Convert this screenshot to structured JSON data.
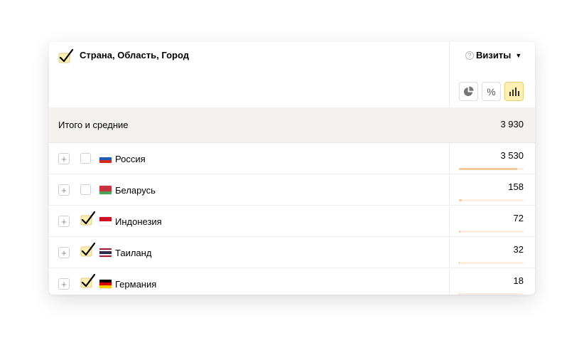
{
  "header": {
    "title": "Страна, Область, Город",
    "metric": "Визиты",
    "help_glyph": "?",
    "caret": "▼",
    "view_buttons": [
      {
        "name": "pie-chart-icon",
        "active": false
      },
      {
        "name": "percent-icon",
        "label": "%",
        "active": false
      },
      {
        "name": "bar-chart-icon",
        "active": true
      }
    ]
  },
  "totals": {
    "label": "Итого и средние",
    "value": "3 930"
  },
  "rows": [
    {
      "label": "Россия",
      "value": "3 530",
      "share": 0.898,
      "checked": false,
      "flag": "ru"
    },
    {
      "label": "Беларусь",
      "value": "158",
      "share": 0.04,
      "checked": false,
      "flag": "by"
    },
    {
      "label": "Индонезия",
      "value": "72",
      "share": 0.018,
      "checked": true,
      "flag": "id"
    },
    {
      "label": "Таиланд",
      "value": "32",
      "share": 0.008,
      "checked": true,
      "flag": "th"
    },
    {
      "label": "Германия",
      "value": "18",
      "share": 0.005,
      "checked": true,
      "flag": "de"
    }
  ],
  "colors": {
    "bar_fill": "#f2c99b",
    "bar_track": "#fdeedd",
    "active_button": "#fdefb3",
    "checkbox_fill": "#fdefb3",
    "totals_bg": "#f3f2ef"
  }
}
